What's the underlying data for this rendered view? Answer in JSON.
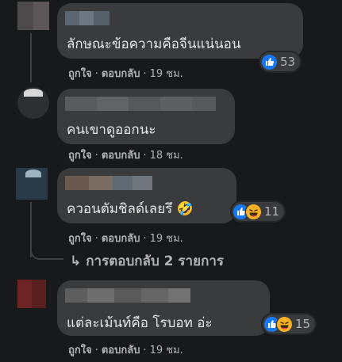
{
  "comments": [
    {
      "text": "ลักษณะข้อความคือจีนแน่นอน",
      "like": "ถูกใจ",
      "reply": "ตอบกลับ",
      "time": "19 ชม.",
      "reaction_count": "53",
      "reactions": [
        "like-icon"
      ]
    },
    {
      "text": "คนเขาดูออกนะ",
      "like": "ถูกใจ",
      "reply": "ตอบกลับ",
      "time": "18 ชม.",
      "reaction_count": "",
      "reactions": []
    },
    {
      "text": "ควอนตัมชิลด์เลยรึ 🤣",
      "like": "ถูกใจ",
      "reply": "ตอบกลับ",
      "time": "19 ชม.",
      "reaction_count": "11",
      "reactions": [
        "like-icon",
        "haha-icon"
      ]
    },
    {
      "text": "แต่ละเม้นท์คือ โรบอท อ่ะ",
      "like": "ถูกใจ",
      "reply": "ตอบกลับ",
      "time": "19 ชม.",
      "reaction_count": "15",
      "reactions": [
        "like-icon",
        "haha-icon"
      ]
    }
  ],
  "replies_link": "การตอบกลับ 2 รายการ",
  "separator": "·",
  "colors": {
    "background": "#18191a",
    "bubble": "#3a3b3c",
    "text": "#e4e6eb",
    "secondary": "#b0b3b8",
    "like": "#1877f2",
    "haha": "#f7b125"
  }
}
